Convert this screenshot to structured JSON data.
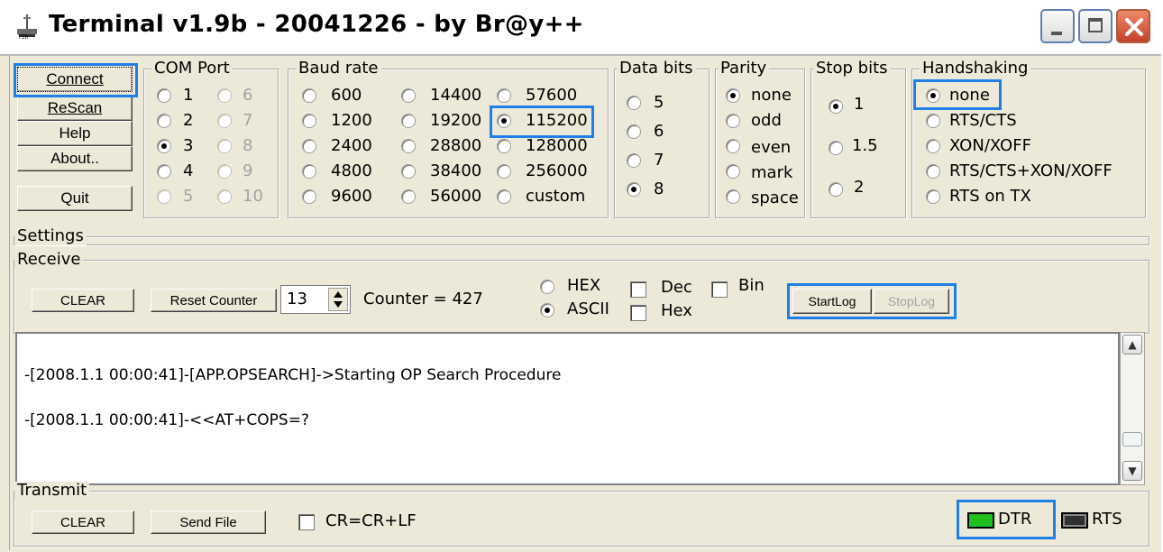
{
  "window": {
    "title": "Terminal v1.9b - 20041226 - by Br@y++"
  },
  "buttons": {
    "connect": "Connect",
    "rescan": "ReScan",
    "help": "Help",
    "about": "About..",
    "quit": "Quit"
  },
  "com_port": {
    "title": "COM Port",
    "ports": [
      {
        "label": "1",
        "enabled": true
      },
      {
        "label": "6",
        "enabled": false
      },
      {
        "label": "2",
        "enabled": true
      },
      {
        "label": "7",
        "enabled": false
      },
      {
        "label": "3",
        "enabled": true,
        "selected": true
      },
      {
        "label": "8",
        "enabled": false
      },
      {
        "label": "4",
        "enabled": true
      },
      {
        "label": "9",
        "enabled": false
      },
      {
        "label": "5",
        "enabled": false
      },
      {
        "label": "10",
        "enabled": false
      }
    ]
  },
  "baud_rate": {
    "title": "Baud rate",
    "options": [
      "600",
      "14400",
      "57600",
      "1200",
      "19200",
      "115200",
      "2400",
      "28800",
      "128000",
      "4800",
      "38400",
      "256000",
      "9600",
      "56000",
      "custom"
    ],
    "selected": "115200"
  },
  "data_bits": {
    "title": "Data bits",
    "options": [
      "5",
      "6",
      "7",
      "8"
    ],
    "selected": "8"
  },
  "parity": {
    "title": "Parity",
    "options": [
      "none",
      "odd",
      "even",
      "mark",
      "space"
    ],
    "selected": "none"
  },
  "stop_bits": {
    "title": "Stop bits",
    "options": [
      "1",
      "1.5",
      "2"
    ],
    "selected": "1"
  },
  "handshaking": {
    "title": "Handshaking",
    "options": [
      "none",
      "RTS/CTS",
      "XON/XOFF",
      "RTS/CTS+XON/XOFF",
      "RTS on TX"
    ],
    "selected": "none"
  },
  "settings": {
    "title": "Settings"
  },
  "receive": {
    "title": "Receive",
    "clear": "CLEAR",
    "reset_counter": "Reset Counter",
    "counter_spin_value": "13",
    "counter_label": "Counter = 427",
    "hex": "HEX",
    "ascii": "ASCII",
    "mode_selected": "ASCII",
    "dec": "Dec",
    "hex_chk": "Hex",
    "bin": "Bin",
    "start_log": "StartLog",
    "stop_log": "StopLog"
  },
  "log_lines": [
    "-[2008.1.1 00:00:41]-[APP.OPSEARCH]->Starting OP Search Procedure",
    "-[2008.1.1 00:00:41]-<<AT+COPS=?"
  ],
  "transmit": {
    "title": "Transmit",
    "clear": "CLEAR",
    "send_file": "Send File",
    "cr_lf": "CR=CR+LF",
    "dtr": "DTR",
    "rts": "RTS"
  },
  "colors": {
    "accent_highlight": "#1f7fe8",
    "led_on": "#20c020",
    "led_off": "#303030"
  }
}
